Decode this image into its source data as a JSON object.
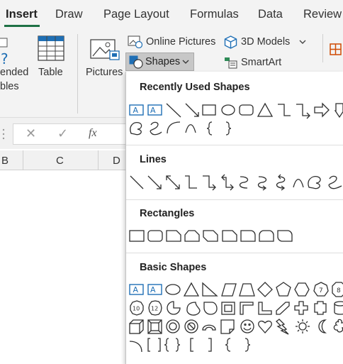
{
  "tabs": [
    {
      "label": "Insert",
      "active": true
    },
    {
      "label": "Draw"
    },
    {
      "label": "Page Layout"
    },
    {
      "label": "Formulas"
    },
    {
      "label": "Data"
    },
    {
      "label": "Review"
    }
  ],
  "ribbon": {
    "recommended_label_line1": "ended",
    "recommended_label_line2": "bles",
    "table_label": "Table",
    "pictures_label": "Pictures",
    "online_pictures_label": "Online Pictures",
    "models_label": "3D Models",
    "shapes_label": "Shapes",
    "smartart_label": "SmartArt"
  },
  "formula_bar": {
    "cancel_symbol": "✕",
    "enter_symbol": "✓",
    "fx_label": "fx"
  },
  "columns": [
    "B",
    "C",
    "D"
  ],
  "shapes_menu": {
    "sections": [
      {
        "title": "Recently Used Shapes"
      },
      {
        "title": "Lines"
      },
      {
        "title": "Rectangles"
      },
      {
        "title": "Basic Shapes"
      }
    ],
    "numbered_labels": [
      "7",
      "8",
      "10",
      "12"
    ]
  },
  "colors": {
    "ribbon_bg": "#f3f3f3",
    "accent_green": "#1e7145",
    "shape_stroke": "#2f2f2f",
    "text_box_blue": "#1f6fb5",
    "shapes_button_pressed": "#c7c7c7"
  }
}
